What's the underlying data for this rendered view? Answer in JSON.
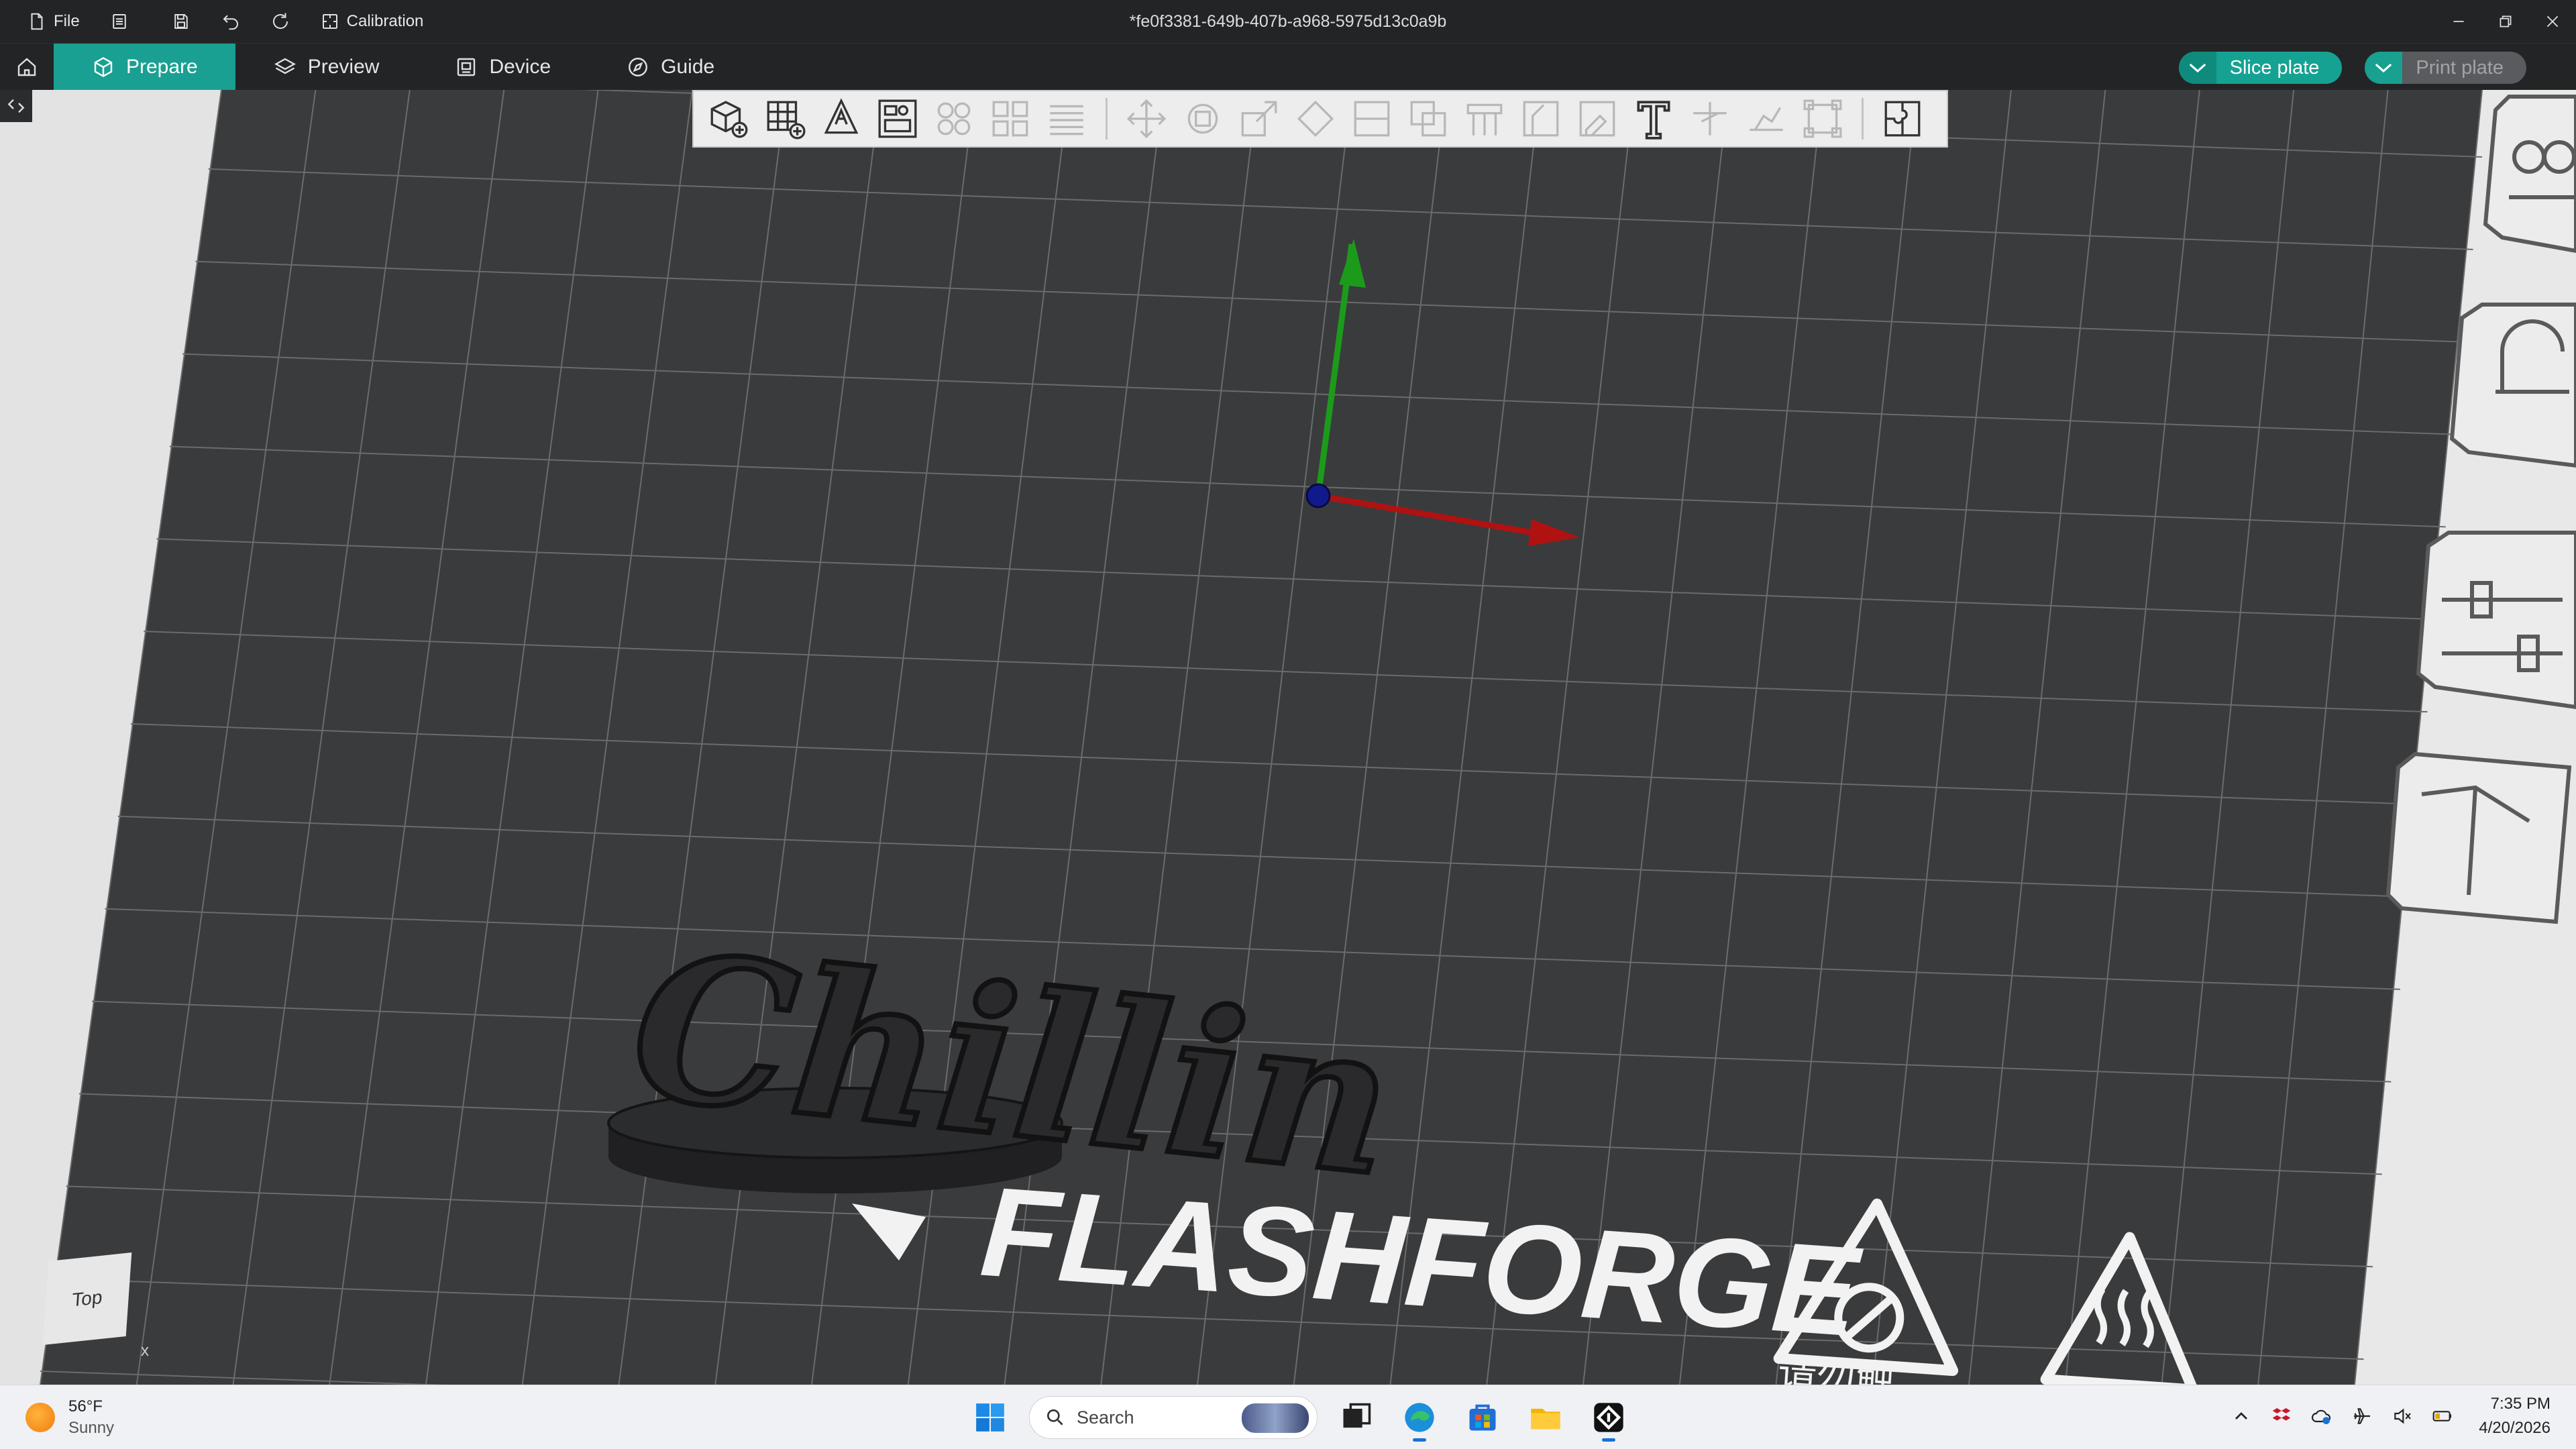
{
  "titlebar": {
    "file_label": "File",
    "calibration_label": "Calibration",
    "document_title": "*fe0f3381-649b-407b-a968-5975d13c0a9b"
  },
  "tabs": {
    "prepare": "Prepare",
    "preview": "Preview",
    "device": "Device",
    "guide": "Guide"
  },
  "actions": {
    "slice_plate": "Slice plate",
    "print_plate": "Print plate"
  },
  "viewport": {
    "model_text": "Chillin",
    "bed_brand": "FLASHFORGE",
    "bed_warning_cjk": "请勿触",
    "nav_cube_face": "Top",
    "axis_x_label": "x",
    "colors": {
      "bed": "#3a3b3d",
      "grid": "#6a6b6d",
      "accent": "#1aa092",
      "axis_y": "#1c9a1c",
      "axis_x": "#b01212",
      "axis_origin": "#111a8c"
    }
  },
  "taskbar": {
    "temperature": "56°F",
    "condition": "Sunny",
    "search_placeholder": "Search",
    "time": "7:35 PM",
    "date": "4/20/2026"
  }
}
